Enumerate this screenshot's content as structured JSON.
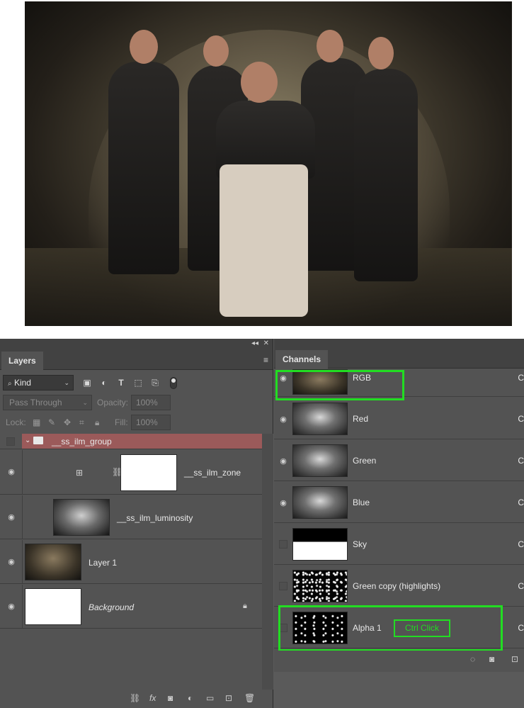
{
  "photo": {},
  "layers": {
    "tab_label": "Layers",
    "topbar_collapse": "◂◂",
    "topbar_close": "✕",
    "menu_icon": "≡",
    "kind_label": "Kind",
    "blend_mode": "Pass Through",
    "opacity_label": "Opacity:",
    "opacity_value": "100%",
    "lock_label": "Lock:",
    "fill_label": "Fill:",
    "fill_value": "100%",
    "items": [
      {
        "name": "__ss_ilm_group"
      },
      {
        "name": "__ss_ilm_zone"
      },
      {
        "name": "__ss_ilm_luminosity"
      },
      {
        "name": "Layer 1"
      },
      {
        "name": "Background"
      }
    ]
  },
  "channels": {
    "tab_label": "Channels",
    "items": [
      {
        "name": "RGB",
        "shortcut": "C"
      },
      {
        "name": "Red",
        "shortcut": "C"
      },
      {
        "name": "Green",
        "shortcut": "C"
      },
      {
        "name": "Blue",
        "shortcut": "C"
      },
      {
        "name": "Sky",
        "shortcut": "C"
      },
      {
        "name": "Green copy (highlights)",
        "shortcut": "C"
      },
      {
        "name": "Alpha 1",
        "shortcut": "C"
      }
    ],
    "annotation": "Ctrl Click"
  },
  "colors": {
    "highlight": "#22dd22",
    "group_row": "#9b5a5a",
    "panel_bg": "#535353"
  }
}
